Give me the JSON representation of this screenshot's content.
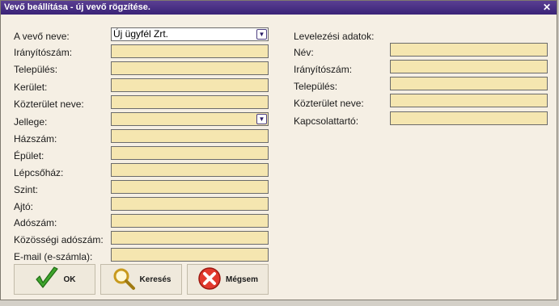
{
  "window": {
    "title": "Vevő beállítása - új vevő rögzítése.",
    "close_icon": "close-icon"
  },
  "left_form": {
    "customer_name": {
      "label": "A vevő neve:",
      "value": "Új ügyfél Zrt."
    },
    "postal_code": {
      "label": "Irányítószám:"
    },
    "city": {
      "label": "Település:"
    },
    "district": {
      "label": "Kerület:"
    },
    "street_name": {
      "label": "Közterület neve:"
    },
    "street_type": {
      "label": "Jellege:"
    },
    "house_number": {
      "label": "Házszám:"
    },
    "building": {
      "label": "Épület:"
    },
    "staircase": {
      "label": "Lépcsőház:"
    },
    "floor": {
      "label": "Szint:"
    },
    "door": {
      "label": "Ajtó:"
    },
    "tax_number": {
      "label": "Adószám:"
    },
    "eu_tax_number": {
      "label": "Közösségi adószám:"
    },
    "email": {
      "label": "E-mail (e-számla):"
    }
  },
  "right_form": {
    "section_title": "Levelezési adatok:",
    "name": {
      "label": "Név:"
    },
    "postal_code": {
      "label": "Irányítószám:"
    },
    "city": {
      "label": "Település:"
    },
    "street_name": {
      "label": "Közterület neve:"
    },
    "contact": {
      "label": "Kapcsolattartó:"
    }
  },
  "buttons": {
    "ok": {
      "label": "OK",
      "icon": "checkmark-icon"
    },
    "search": {
      "label": "Keresés",
      "icon": "magnifier-icon"
    },
    "cancel": {
      "label": "Mégsem",
      "icon": "cancel-icon"
    }
  },
  "colors": {
    "title_bar": "#3f2a7f",
    "window_bg": "#f5efe4",
    "field_bg": "#f5e6b0"
  }
}
